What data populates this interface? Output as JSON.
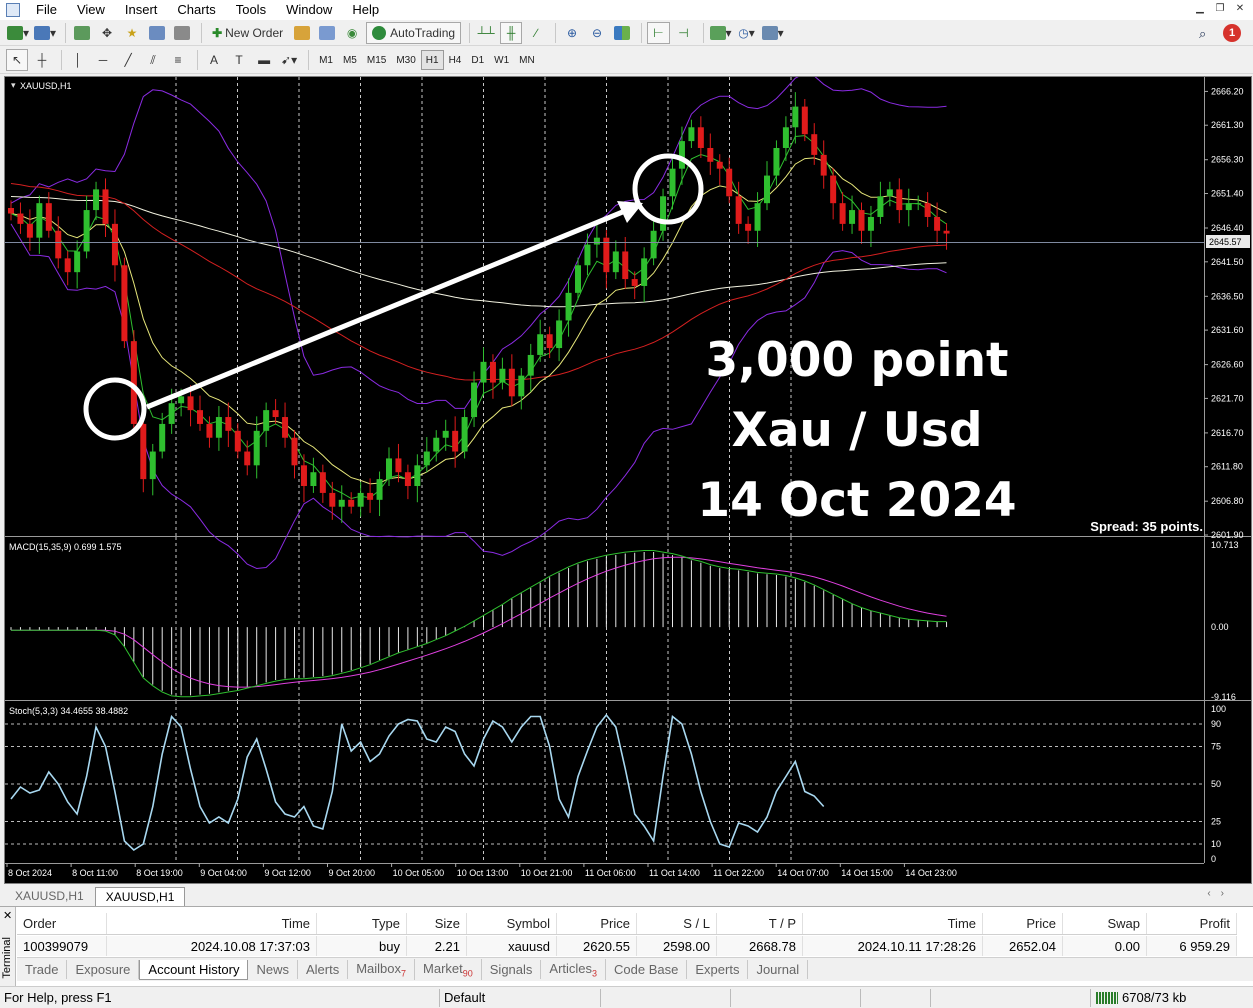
{
  "menu": [
    "File",
    "View",
    "Insert",
    "Charts",
    "Tools",
    "Window",
    "Help"
  ],
  "toolbar": {
    "new_order": "New Order",
    "autotrading": "AutoTrading",
    "timeframes": [
      "M1",
      "M5",
      "M15",
      "M30",
      "H1",
      "H4",
      "D1",
      "W1",
      "MN"
    ],
    "active_timeframe": "H1",
    "notification_count": "1"
  },
  "chart": {
    "symbol_label": "XAUUSD,H1",
    "current_price": "2645.57",
    "spread": "Spread: 35 points.",
    "annotation": [
      "3,000 point",
      "Xau / Usd",
      "14 Oct 2024"
    ],
    "price_ticks": [
      "2666.20",
      "2661.30",
      "2656.30",
      "2651.40",
      "2646.40",
      "2641.50",
      "2636.50",
      "2631.60",
      "2626.60",
      "2621.70",
      "2616.70",
      "2611.80",
      "2606.80",
      "2601.90"
    ],
    "time_ticks": [
      "8 Oct 2024",
      "8 Oct 11:00",
      "8 Oct 19:00",
      "9 Oct 04:00",
      "9 Oct 12:00",
      "9 Oct 20:00",
      "10 Oct 05:00",
      "10 Oct 13:00",
      "10 Oct 21:00",
      "11 Oct 06:00",
      "11 Oct 14:00",
      "11 Oct 22:00",
      "14 Oct 07:00",
      "14 Oct 15:00",
      "14 Oct 23:00"
    ],
    "macd_label": "MACD(15,35,9) 0.699 1.575",
    "macd_ticks": [
      "10.713",
      "0.00",
      "-9.116"
    ],
    "stoch_label": "Stoch(5,3,3) 34.4655 38.4882",
    "stoch_ticks": [
      "100",
      "90",
      "75",
      "50",
      "25",
      "10",
      "0"
    ],
    "colors": {
      "bull": "#2fbf2f",
      "bear": "#e01b1b",
      "bands": "#8a2be2",
      "ma_red": "#d42020",
      "ma_white": "#f2f2e0",
      "ma_yellow": "#e6e67a",
      "ma_green": "#2fbf2f",
      "macd_signal": "#e040e0",
      "stoch": "#a8d8f0"
    }
  },
  "chart_data": {
    "type": "candlestick",
    "symbol": "XAUUSD",
    "timeframe": "H1",
    "ylim": [
      2601.9,
      2668.0
    ],
    "close_series": [
      2648.5,
      2647,
      2645,
      2650,
      2646,
      2642,
      2640,
      2643,
      2649,
      2652,
      2647,
      2641,
      2630,
      2618,
      2610,
      2614,
      2618,
      2621,
      2622,
      2620,
      2618,
      2616,
      2619,
      2617,
      2614,
      2612,
      2617,
      2620,
      2619,
      2616,
      2612,
      2609,
      2611,
      2608,
      2606,
      2607,
      2606,
      2608,
      2607,
      2610,
      2613,
      2611,
      2609,
      2612,
      2614,
      2616,
      2617,
      2614,
      2619,
      2624,
      2627,
      2624,
      2626,
      2622,
      2625,
      2628,
      2631,
      2629,
      2633,
      2637,
      2641,
      2644,
      2645,
      2640,
      2643,
      2639,
      2638,
      2642,
      2646,
      2651,
      2655,
      2659,
      2661,
      2658,
      2656,
      2655,
      2651,
      2647,
      2646,
      2650,
      2654,
      2658,
      2661,
      2664,
      2660,
      2657,
      2654,
      2650,
      2647,
      2649,
      2646,
      2648,
      2651,
      2652,
      2649,
      2650,
      2650,
      2648,
      2646,
      2645.6
    ],
    "macd_histogram": [
      -0.4,
      -0.4,
      -0.4,
      -0.4,
      -0.4,
      -0.4,
      -0.4,
      -0.4,
      -0.4,
      -0.4,
      -0.5,
      -1,
      -2.5,
      -4.5,
      -6.5,
      -7.5,
      -8.3,
      -8.8,
      -8.9,
      -8.9,
      -8.8,
      -8.7,
      -8.5,
      -8.3,
      -8.1,
      -7.8,
      -7.5,
      -7.2,
      -6.9,
      -6.7,
      -6.6,
      -6.6,
      -6.5,
      -6.4,
      -6.2,
      -5.9,
      -5.6,
      -5.2,
      -4.8,
      -4.3,
      -3.8,
      -3.3,
      -2.9,
      -2.5,
      -2.1,
      -1.6,
      -1.1,
      -0.5,
      0.1,
      0.8,
      1.5,
      2.2,
      2.9,
      3.7,
      4.4,
      5.1,
      5.8,
      6.5,
      7.1,
      7.7,
      8.2,
      8.6,
      8.9,
      9.2,
      9.4,
      9.6,
      9.7,
      9.8,
      9.8,
      9.6,
      9.4,
      9.1,
      8.7,
      8.4,
      8.0,
      7.7,
      7.5,
      7.4,
      7.2,
      7.0,
      6.9,
      6.8,
      6.6,
      6.3,
      5.9,
      5.4,
      4.8,
      4.2,
      3.6,
      3.0,
      2.5,
      2.1,
      1.8,
      1.5,
      1.2,
      1.0,
      0.9,
      0.8,
      0.7,
      0.7
    ],
    "stochastic_k": [
      40,
      48,
      44,
      46,
      58,
      50,
      38,
      30,
      55,
      88,
      75,
      45,
      12,
      6,
      10,
      35,
      70,
      95,
      88,
      60,
      35,
      24,
      28,
      24,
      40,
      68,
      80,
      60,
      38,
      30,
      28,
      35,
      22,
      20,
      45,
      90,
      72,
      78,
      65,
      70,
      82,
      90,
      93,
      92,
      80,
      78,
      88,
      85,
      70,
      62,
      80,
      92,
      88,
      78,
      88,
      95,
      95,
      75,
      40,
      28,
      55,
      72,
      88,
      96,
      88,
      60,
      30,
      22,
      12,
      55,
      95,
      90,
      70,
      45,
      25,
      10,
      8,
      24,
      22,
      18,
      28,
      45,
      55,
      65,
      45,
      42,
      35
    ]
  },
  "chart_tabs": [
    "XAUUSD,H1",
    "XAUUSD,H1"
  ],
  "table": {
    "headers": [
      "Order",
      "Time",
      "Type",
      "Size",
      "Symbol",
      "Price",
      "S / L",
      "T / P",
      "Time",
      "Price",
      "Swap",
      "Profit"
    ],
    "rows": [
      [
        "100399079",
        "2024.10.08 17:37:03",
        "buy",
        "2.21",
        "xauusd",
        "2620.55",
        "2598.00",
        "2668.78",
        "2024.10.11 17:28:26",
        "2652.04",
        "0.00",
        "6 959.29"
      ]
    ]
  },
  "terminal_label": "Terminal",
  "terminal_tabs": [
    {
      "label": "Trade",
      "badge": ""
    },
    {
      "label": "Exposure",
      "badge": ""
    },
    {
      "label": "Account History",
      "badge": ""
    },
    {
      "label": "News",
      "badge": ""
    },
    {
      "label": "Alerts",
      "badge": ""
    },
    {
      "label": "Mailbox",
      "badge": "7"
    },
    {
      "label": "Market",
      "badge": "90"
    },
    {
      "label": "Signals",
      "badge": ""
    },
    {
      "label": "Articles",
      "badge": "3"
    },
    {
      "label": "Code Base",
      "badge": ""
    },
    {
      "label": "Experts",
      "badge": ""
    },
    {
      "label": "Journal",
      "badge": ""
    }
  ],
  "status": {
    "help": "For Help, press F1",
    "profile": "Default",
    "traffic": "6708/73 kb"
  }
}
